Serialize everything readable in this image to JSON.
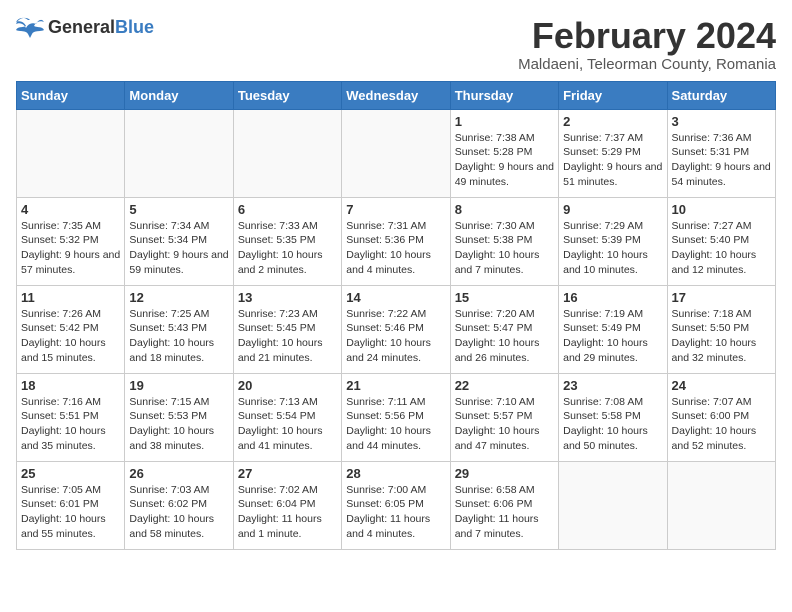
{
  "logo": {
    "general": "General",
    "blue": "Blue"
  },
  "title": "February 2024",
  "subtitle": "Maldaeni, Teleorman County, Romania",
  "days_of_week": [
    "Sunday",
    "Monday",
    "Tuesday",
    "Wednesday",
    "Thursday",
    "Friday",
    "Saturday"
  ],
  "weeks": [
    [
      {
        "day": "",
        "info": ""
      },
      {
        "day": "",
        "info": ""
      },
      {
        "day": "",
        "info": ""
      },
      {
        "day": "",
        "info": ""
      },
      {
        "day": "1",
        "info": "Sunrise: 7:38 AM\nSunset: 5:28 PM\nDaylight: 9 hours and 49 minutes."
      },
      {
        "day": "2",
        "info": "Sunrise: 7:37 AM\nSunset: 5:29 PM\nDaylight: 9 hours and 51 minutes."
      },
      {
        "day": "3",
        "info": "Sunrise: 7:36 AM\nSunset: 5:31 PM\nDaylight: 9 hours and 54 minutes."
      }
    ],
    [
      {
        "day": "4",
        "info": "Sunrise: 7:35 AM\nSunset: 5:32 PM\nDaylight: 9 hours and 57 minutes."
      },
      {
        "day": "5",
        "info": "Sunrise: 7:34 AM\nSunset: 5:34 PM\nDaylight: 9 hours and 59 minutes."
      },
      {
        "day": "6",
        "info": "Sunrise: 7:33 AM\nSunset: 5:35 PM\nDaylight: 10 hours and 2 minutes."
      },
      {
        "day": "7",
        "info": "Sunrise: 7:31 AM\nSunset: 5:36 PM\nDaylight: 10 hours and 4 minutes."
      },
      {
        "day": "8",
        "info": "Sunrise: 7:30 AM\nSunset: 5:38 PM\nDaylight: 10 hours and 7 minutes."
      },
      {
        "day": "9",
        "info": "Sunrise: 7:29 AM\nSunset: 5:39 PM\nDaylight: 10 hours and 10 minutes."
      },
      {
        "day": "10",
        "info": "Sunrise: 7:27 AM\nSunset: 5:40 PM\nDaylight: 10 hours and 12 minutes."
      }
    ],
    [
      {
        "day": "11",
        "info": "Sunrise: 7:26 AM\nSunset: 5:42 PM\nDaylight: 10 hours and 15 minutes."
      },
      {
        "day": "12",
        "info": "Sunrise: 7:25 AM\nSunset: 5:43 PM\nDaylight: 10 hours and 18 minutes."
      },
      {
        "day": "13",
        "info": "Sunrise: 7:23 AM\nSunset: 5:45 PM\nDaylight: 10 hours and 21 minutes."
      },
      {
        "day": "14",
        "info": "Sunrise: 7:22 AM\nSunset: 5:46 PM\nDaylight: 10 hours and 24 minutes."
      },
      {
        "day": "15",
        "info": "Sunrise: 7:20 AM\nSunset: 5:47 PM\nDaylight: 10 hours and 26 minutes."
      },
      {
        "day": "16",
        "info": "Sunrise: 7:19 AM\nSunset: 5:49 PM\nDaylight: 10 hours and 29 minutes."
      },
      {
        "day": "17",
        "info": "Sunrise: 7:18 AM\nSunset: 5:50 PM\nDaylight: 10 hours and 32 minutes."
      }
    ],
    [
      {
        "day": "18",
        "info": "Sunrise: 7:16 AM\nSunset: 5:51 PM\nDaylight: 10 hours and 35 minutes."
      },
      {
        "day": "19",
        "info": "Sunrise: 7:15 AM\nSunset: 5:53 PM\nDaylight: 10 hours and 38 minutes."
      },
      {
        "day": "20",
        "info": "Sunrise: 7:13 AM\nSunset: 5:54 PM\nDaylight: 10 hours and 41 minutes."
      },
      {
        "day": "21",
        "info": "Sunrise: 7:11 AM\nSunset: 5:56 PM\nDaylight: 10 hours and 44 minutes."
      },
      {
        "day": "22",
        "info": "Sunrise: 7:10 AM\nSunset: 5:57 PM\nDaylight: 10 hours and 47 minutes."
      },
      {
        "day": "23",
        "info": "Sunrise: 7:08 AM\nSunset: 5:58 PM\nDaylight: 10 hours and 50 minutes."
      },
      {
        "day": "24",
        "info": "Sunrise: 7:07 AM\nSunset: 6:00 PM\nDaylight: 10 hours and 52 minutes."
      }
    ],
    [
      {
        "day": "25",
        "info": "Sunrise: 7:05 AM\nSunset: 6:01 PM\nDaylight: 10 hours and 55 minutes."
      },
      {
        "day": "26",
        "info": "Sunrise: 7:03 AM\nSunset: 6:02 PM\nDaylight: 10 hours and 58 minutes."
      },
      {
        "day": "27",
        "info": "Sunrise: 7:02 AM\nSunset: 6:04 PM\nDaylight: 11 hours and 1 minute."
      },
      {
        "day": "28",
        "info": "Sunrise: 7:00 AM\nSunset: 6:05 PM\nDaylight: 11 hours and 4 minutes."
      },
      {
        "day": "29",
        "info": "Sunrise: 6:58 AM\nSunset: 6:06 PM\nDaylight: 11 hours and 7 minutes."
      },
      {
        "day": "",
        "info": ""
      },
      {
        "day": "",
        "info": ""
      }
    ]
  ]
}
